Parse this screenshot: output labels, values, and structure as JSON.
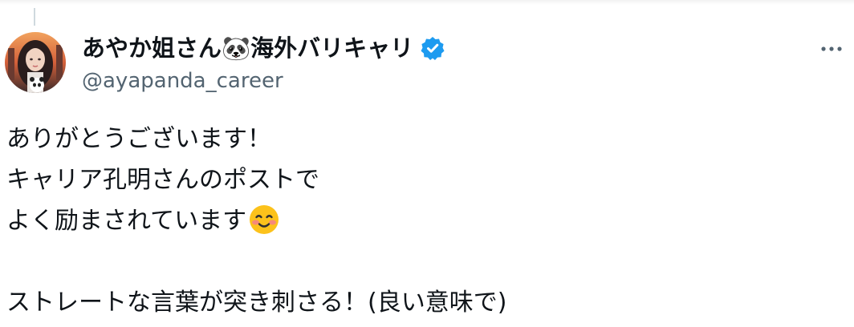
{
  "tweet": {
    "author": {
      "display_name": "あやか姐さん🐼海外バリキャリ",
      "handle": "@ayapanda_career",
      "verified": true,
      "verified_color": "#1d9bf0"
    },
    "more_icon": "more-horizontal-icon",
    "text_lines": [
      "ありがとうございます！",
      "キャリア孔明さんのポストで",
      "よく励まされています"
    ],
    "text_emoji": "smiling-face-with-blush-emoji",
    "text_last_line": "ストレートな言葉が突き刺さる！(良い意味で)",
    "colors": {
      "text": "#0f1419",
      "secondary": "#536471",
      "thread_line": "#cfd9de"
    }
  }
}
